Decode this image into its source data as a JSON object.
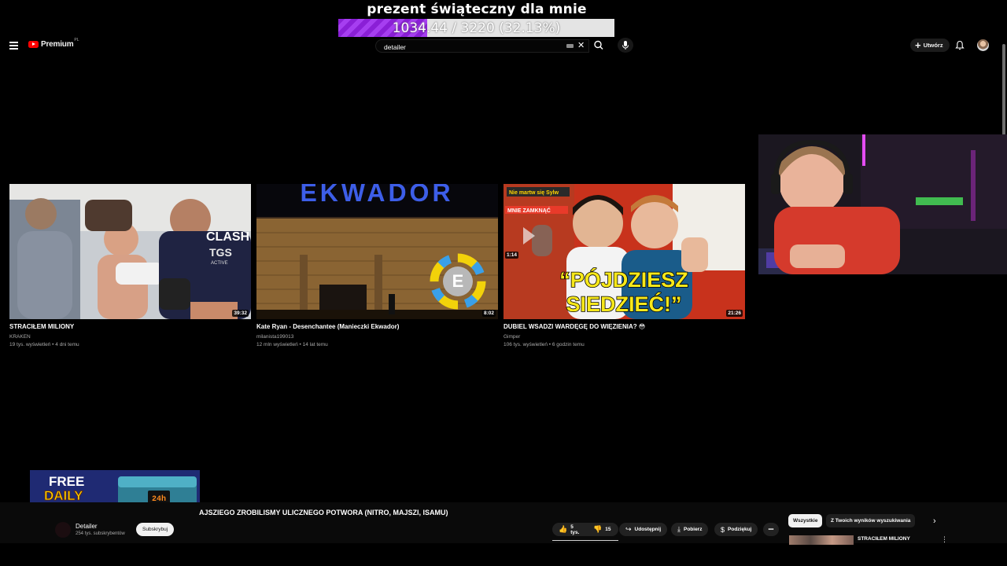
{
  "overlay": {
    "goal_title": "prezent świąteczny dla mnie",
    "goal_text": "1034.44 / 3220 (32.13%)",
    "goal_progress": 0.3213,
    "goal_color": "#8a1fd6"
  },
  "masthead": {
    "menu_icon": "hamburger-icon",
    "logo_text": "Premium",
    "logo_country": "PL",
    "search_value": "detailer",
    "create_label": "Utwórz",
    "bell_icon": "bell-icon"
  },
  "videos": [
    {
      "title": "STRACIŁEM MILIONY",
      "channel": "KRAKEN",
      "meta": "19 tys. wyświetleń • 4 dni temu",
      "duration": "39:32"
    },
    {
      "title": "Kate Ryan - Desenchantee (Manieczki Ekwador)",
      "channel": "milanista199013",
      "meta": "12 mln wyświetleń • 14 lat temu",
      "duration": "8:02"
    },
    {
      "title": "DUBIEL WSADZI WARDĘGĘ DO WIĘZIENIA? 😳",
      "channel": "Gimper",
      "meta": "106 tys. wyświetleń • 6 godzin temu",
      "duration": "21:26"
    }
  ],
  "thumb_text": {
    "v2_sign": "EKWADOR",
    "v3_big1": "“PÓJDZIESZ",
    "v3_big2": "SIEDZIEĆ!”",
    "v3_banner": "Nie martw się Sylw",
    "v3_banner2": "MNIE ZAMKNĄĆ",
    "v1_shirt": "CLASH",
    "v1_shirt2": "TGS",
    "v1_shirt3": "ACTIVE"
  },
  "promo": {
    "line1": "FREE",
    "line2": "DAILY",
    "badge": "24h"
  },
  "player": {
    "now_title": "AJSZIEGO ZROBILISMY ULICZNEGO POTWORA (NITRO, MAJSZI, ISAMU)",
    "channel_name": "Detailer",
    "channel_subs": "254 tys. subskrybentów",
    "subscribe": "Subskrybuj",
    "likes": "5 tys.",
    "dislikes": "15",
    "share": "Udostępnij",
    "download": "Pobierz",
    "thanks": "Podziękuj"
  },
  "chips": {
    "all": "Wszystkie",
    "from_search": "Z Twoich wyników wyszukiwania"
  },
  "related": {
    "title": "STRACIŁEM MILIONY"
  }
}
